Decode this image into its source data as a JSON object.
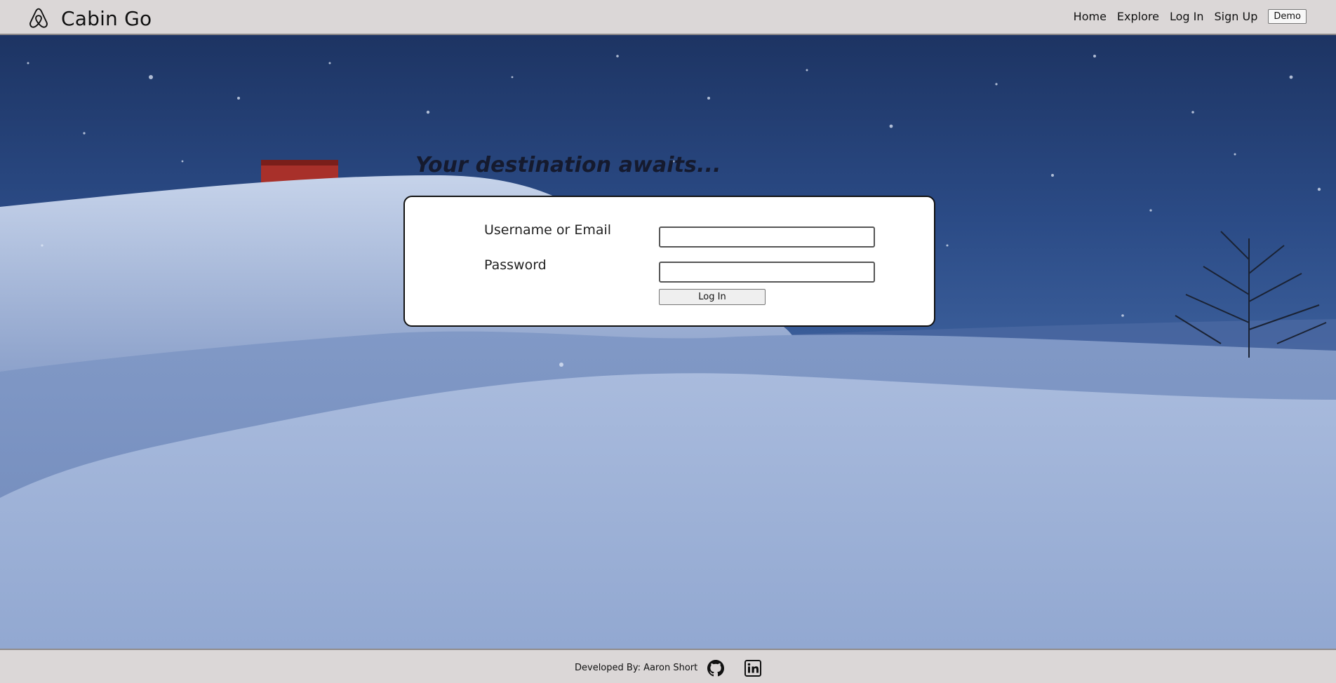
{
  "navbar": {
    "brand_title": "Cabin Go",
    "links": {
      "home": "Home",
      "explore": "Explore",
      "login": "Log In",
      "signup": "Sign Up"
    },
    "demo_label": "Demo"
  },
  "hero": {
    "tagline": "Your destination awaits..."
  },
  "login_form": {
    "username_label": "Username or Email",
    "username_value": "",
    "password_label": "Password",
    "password_value": "",
    "submit_label": "Log In"
  },
  "footer": {
    "credit": "Developed By: Aaron Short",
    "icons": [
      "github-icon",
      "linkedin-icon"
    ]
  },
  "colors": {
    "navbar_bg": "#dbd7d7",
    "sky": "#2b4b86",
    "snow": "#9db1d6",
    "chimney": "#a8302a",
    "card_bg": "#ffffff"
  }
}
